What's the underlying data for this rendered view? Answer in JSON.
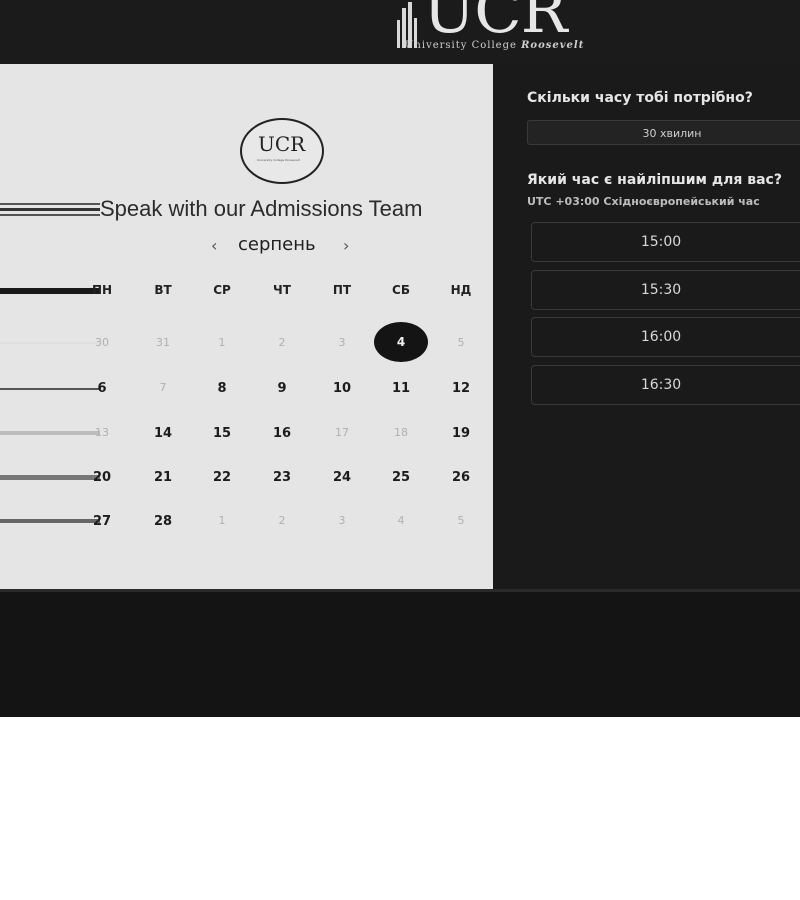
{
  "header": {
    "logo_letters": "UCR",
    "logo_tagline_main": "University College",
    "logo_tagline_accent": "Roosevelt"
  },
  "calendar": {
    "badge_letters": "UCR",
    "badge_mini_text": "University College Roosevelt",
    "title": "Speak with our Admissions Team",
    "month": "серпень",
    "prev_arrow": "‹",
    "next_arrow": "›",
    "weekdays": [
      "ПН",
      "ВТ",
      "СР",
      "ЧТ",
      "ПТ",
      "СБ",
      "НД"
    ],
    "weeks": [
      [
        {
          "d": "30",
          "s": "muted"
        },
        {
          "d": "31",
          "s": "muted"
        },
        {
          "d": "1",
          "s": "muted"
        },
        {
          "d": "2",
          "s": "muted"
        },
        {
          "d": "3",
          "s": "muted"
        },
        {
          "d": "4",
          "s": "selected"
        },
        {
          "d": "5",
          "s": "muted"
        }
      ],
      [
        {
          "d": "6",
          "s": "active"
        },
        {
          "d": "7",
          "s": "muted"
        },
        {
          "d": "8",
          "s": "active"
        },
        {
          "d": "9",
          "s": "active"
        },
        {
          "d": "10",
          "s": "active"
        },
        {
          "d": "11",
          "s": "active"
        },
        {
          "d": "12",
          "s": "active"
        }
      ],
      [
        {
          "d": "13",
          "s": "muted"
        },
        {
          "d": "14",
          "s": "active"
        },
        {
          "d": "15",
          "s": "active"
        },
        {
          "d": "16",
          "s": "active"
        },
        {
          "d": "17",
          "s": "muted"
        },
        {
          "d": "18",
          "s": "muted"
        },
        {
          "d": "19",
          "s": "active"
        }
      ],
      [
        {
          "d": "20",
          "s": "active"
        },
        {
          "d": "21",
          "s": "active"
        },
        {
          "d": "22",
          "s": "active"
        },
        {
          "d": "23",
          "s": "active"
        },
        {
          "d": "24",
          "s": "active"
        },
        {
          "d": "25",
          "s": "active"
        },
        {
          "d": "26",
          "s": "active"
        }
      ],
      [
        {
          "d": "27",
          "s": "active"
        },
        {
          "d": "28",
          "s": "active"
        },
        {
          "d": "1",
          "s": "muted"
        },
        {
          "d": "2",
          "s": "muted"
        },
        {
          "d": "3",
          "s": "muted"
        },
        {
          "d": "4",
          "s": "muted"
        },
        {
          "d": "5",
          "s": "muted"
        }
      ]
    ]
  },
  "booking": {
    "duration_question": "Скільки часу тобі потрібно?",
    "duration_value": "30 хвилин",
    "time_question": "Який час є найліпшим для вас?",
    "timezone": "UTC +03:00 Східноєвропейський час",
    "slots": [
      "15:00",
      "15:30",
      "16:00",
      "16:30"
    ]
  }
}
